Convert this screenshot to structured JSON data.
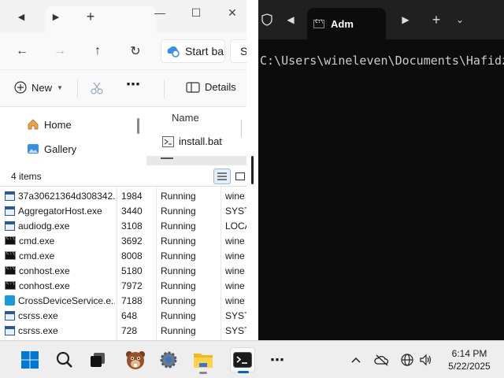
{
  "explorer": {
    "address_text": "Start ba",
    "search_text": "S",
    "toolbar": {
      "new_label": "New",
      "details_label": "Details"
    },
    "nav_items": [
      {
        "label": "Home"
      },
      {
        "label": "Gallery"
      }
    ],
    "column_name": "Name",
    "file": {
      "name": "install.bat"
    },
    "status_count": "4 items"
  },
  "taskmgr": {
    "rows": [
      {
        "name": "37a30621364d308342...",
        "pid": "1984",
        "status": "Running",
        "user": "wine",
        "icon": "window-icon"
      },
      {
        "name": "AggregatorHost.exe",
        "pid": "3440",
        "status": "Running",
        "user": "SYST",
        "icon": "window-icon"
      },
      {
        "name": "audiodg.exe",
        "pid": "3108",
        "status": "Running",
        "user": "LOCA",
        "icon": "window-icon"
      },
      {
        "name": "cmd.exe",
        "pid": "3692",
        "status": "Running",
        "user": "wine",
        "icon": "cmd-icon"
      },
      {
        "name": "cmd.exe",
        "pid": "8008",
        "status": "Running",
        "user": "wine",
        "icon": "cmd-icon"
      },
      {
        "name": "conhost.exe",
        "pid": "5180",
        "status": "Running",
        "user": "wine",
        "icon": "cmd-icon"
      },
      {
        "name": "conhost.exe",
        "pid": "7972",
        "status": "Running",
        "user": "wine",
        "icon": "cmd-icon"
      },
      {
        "name": "CrossDeviceService.e...",
        "pid": "7188",
        "status": "Running",
        "user": "wine",
        "icon": "cross-device-icon"
      },
      {
        "name": "csrss.exe",
        "pid": "648",
        "status": "Running",
        "user": "SYST",
        "icon": "window-icon"
      },
      {
        "name": "csrss.exe",
        "pid": "728",
        "status": "Running",
        "user": "SYST",
        "icon": "window-icon"
      }
    ]
  },
  "terminal": {
    "tab_title": "Adm",
    "prompt_line": "C:\\Users\\wineleven\\Documents\\Hafidz"
  },
  "taskbar": {
    "time": "6:14 PM",
    "date": "5/22/2025"
  }
}
